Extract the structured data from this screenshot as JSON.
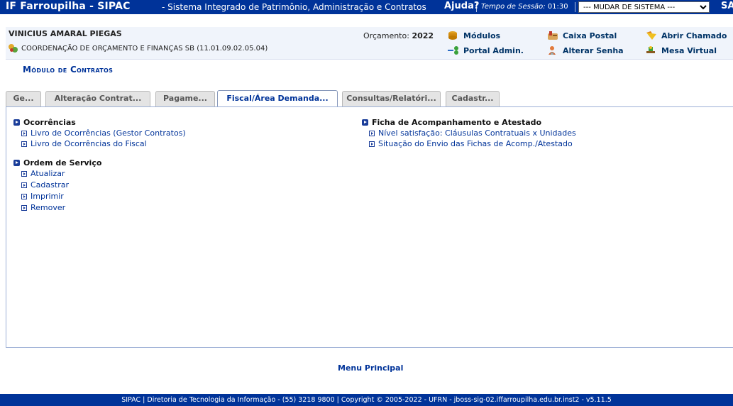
{
  "header": {
    "brand": "IF Farroupilha - SIPAC",
    "subtitle": "- Sistema Integrado de Patrimônio, Administração e Contratos",
    "help": "Ajuda?",
    "session_label": "Tempo de Sessão:",
    "session_time": "01:30",
    "system_select": "--- MUDAR DE SISTEMA ---",
    "logout": "SAIR"
  },
  "user": {
    "name": "VINICIUS AMARAL PIEGAS",
    "unit": "COORDENAÇÃO DE ORÇAMENTO E FINANÇAS SB (11.01.09.02.05.04)",
    "budget_label": "Orçamento:",
    "budget_year": "2022"
  },
  "links": {
    "modulos": "Módulos",
    "caixa_postal": "Caixa Postal",
    "abrir_chamado": "Abrir Chamado",
    "portal_admin": "Portal Admin.",
    "alterar_senha": "Alterar Senha",
    "mesa_virtual": "Mesa Virtual"
  },
  "module_title": "Módulo de Contratos",
  "tabs": [
    {
      "label": "Ge..."
    },
    {
      "label": "Alteração Contrat..."
    },
    {
      "label": "Pagame..."
    },
    {
      "label": "Fiscal/Área Demanda...",
      "active": true
    },
    {
      "label": "Consultas/Relatóri..."
    },
    {
      "label": "Cadastr..."
    }
  ],
  "sections": {
    "ocorrencias": {
      "title": "Ocorrências",
      "items": [
        "Livro de Ocorrências (Gestor Contratos)",
        "Livro de Ocorrências do Fiscal"
      ]
    },
    "ordem_servico": {
      "title": "Ordem de Serviço",
      "items": [
        "Atualizar",
        "Cadastrar",
        "Imprimir",
        "Remover"
      ]
    },
    "ficha": {
      "title": "Ficha de Acompanhamento e Atestado",
      "items": [
        "Nível satisfação: Cláusulas Contratuais x Unidades",
        "Situação do Envio das Fichas de Acomp./Atestado"
      ]
    }
  },
  "menu_principal": "Menu Principal",
  "footer": "SIPAC | Diretoria de Tecnologia da Informação - (55) 3218 9800 | Copyright © 2005-2022 - UFRN - jboss-sig-02.iffarroupilha.edu.br.inst2 - v5.11.5",
  "colors": {
    "header_blue": "#003399",
    "link_blue": "#003399",
    "tab_active_text": "#003399"
  }
}
